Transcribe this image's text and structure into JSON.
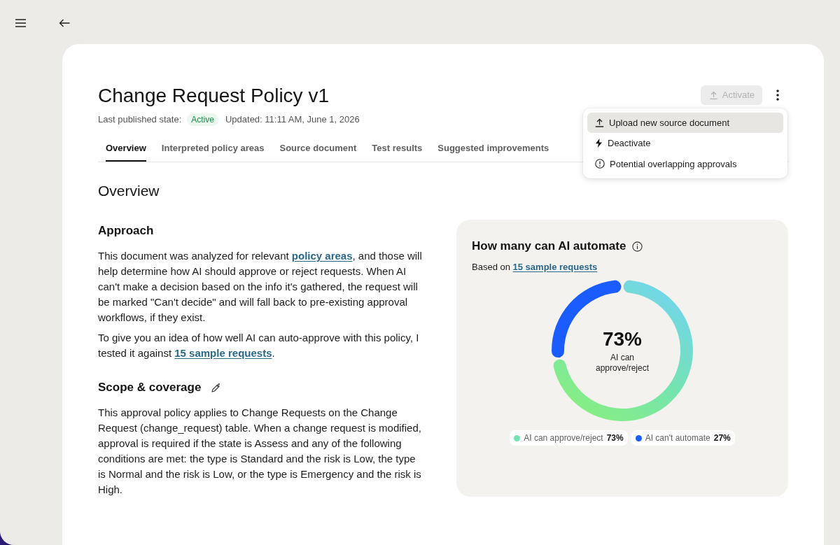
{
  "header": {
    "title": "Change Request Policy v1",
    "meta": {
      "label": "Last published state:",
      "status": "Active",
      "updated": "Updated: 11:11 AM, June 1, 2026"
    },
    "activate_button": {
      "label": "Activate",
      "disabled": true
    },
    "more_menu": {
      "expanded": true,
      "items": [
        {
          "label": "Upload new source document",
          "highlighted": true
        },
        {
          "label": "Deactivate",
          "highlighted": false
        },
        {
          "label": "Potential overlapping approvals",
          "highlighted": false
        }
      ]
    }
  },
  "tabs": [
    {
      "label": "Overview",
      "selected": true
    },
    {
      "label": "Interpreted policy areas",
      "selected": false
    },
    {
      "label": "Source document",
      "selected": false
    },
    {
      "label": "Test results",
      "selected": false
    },
    {
      "label": "Suggested improvements",
      "selected": false
    }
  ],
  "section_title": "Overview",
  "sections": [
    {
      "heading": "Approach",
      "editable": false,
      "paragraphs": [
        [
          {
            "kind": "text",
            "text": "This document was analyzed for relevant "
          },
          {
            "kind": "link",
            "text": "policy areas"
          },
          {
            "kind": "text",
            "text": ", and those will help determine how AI should approve or reject requests. When AI can't make a decision based on the info it's gathered, the request will be marked \"Can't decide\" and will fall back to pre-existing approval workflows, if they exist."
          }
        ],
        [
          {
            "kind": "text",
            "text": "To give you an idea of how well AI can auto-approve with this policy, I tested it against "
          },
          {
            "kind": "link",
            "text": "15 sample requests"
          },
          {
            "kind": "text",
            "text": "."
          }
        ]
      ]
    },
    {
      "heading": "Scope & coverage",
      "editable": true,
      "paragraphs": [
        [
          {
            "kind": "text",
            "text": "This approval policy applies to Change Requests on the Change Request (change_request) table. When a change request is modified, approval is required if the state is Assess and any of the following conditions are met: the type is Standard and the risk is Low, the type is Normal and the risk is Low, or the type is Emergency and the risk is High."
          }
        ]
      ]
    }
  ],
  "automation_panel": {
    "title": "How many can AI automate",
    "subtitle": [
      {
        "kind": "text",
        "text": "Based on "
      },
      {
        "kind": "link",
        "text": "15 sample requests"
      }
    ],
    "chart_data": {
      "type": "donut",
      "values": [
        73,
        27
      ]
    },
    "center_value": "73%",
    "center_label": "AI can approve/reject",
    "legend": [
      {
        "label": "AI can approve/reject",
        "value": "73%",
        "color": "#74e3b2"
      },
      {
        "label": "AI can't automate",
        "value": "27%",
        "color": "#1a5cff"
      }
    ]
  }
}
